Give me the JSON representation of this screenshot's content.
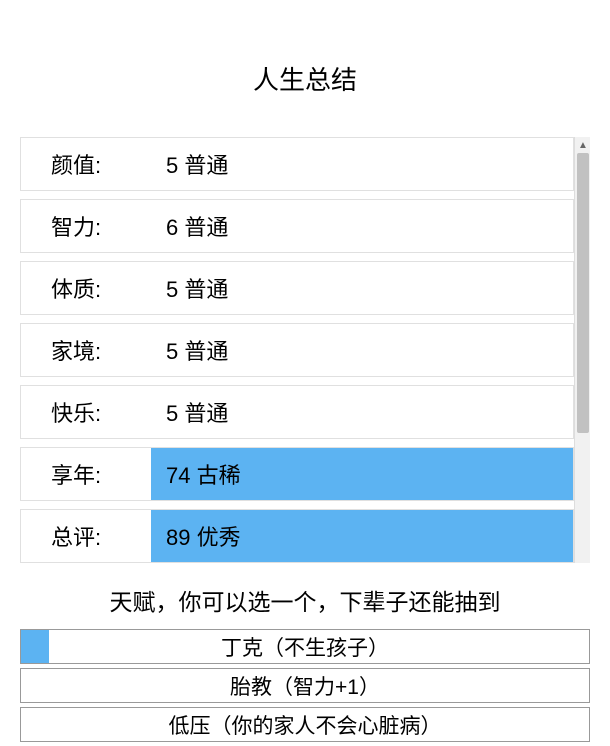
{
  "title": "人生总结",
  "stats": [
    {
      "label": "颜值:",
      "value": "5 普通",
      "highlighted": false
    },
    {
      "label": "智力:",
      "value": "6 普通",
      "highlighted": false
    },
    {
      "label": "体质:",
      "value": "5 普通",
      "highlighted": false
    },
    {
      "label": "家境:",
      "value": "5 普通",
      "highlighted": false
    },
    {
      "label": "快乐:",
      "value": "5 普通",
      "highlighted": false
    },
    {
      "label": "享年:",
      "value": "74 古稀",
      "highlighted": true
    },
    {
      "label": "总评:",
      "value": "89 优秀",
      "highlighted": true
    }
  ],
  "talent_prompt": "天赋，你可以选一个，下辈子还能抽到",
  "talents": [
    {
      "text": "丁克（不生孩子）",
      "selected": true
    },
    {
      "text": "胎教（智力+1）",
      "selected": false
    },
    {
      "text": "低压（你的家人不会心脏病）",
      "selected": false
    }
  ]
}
